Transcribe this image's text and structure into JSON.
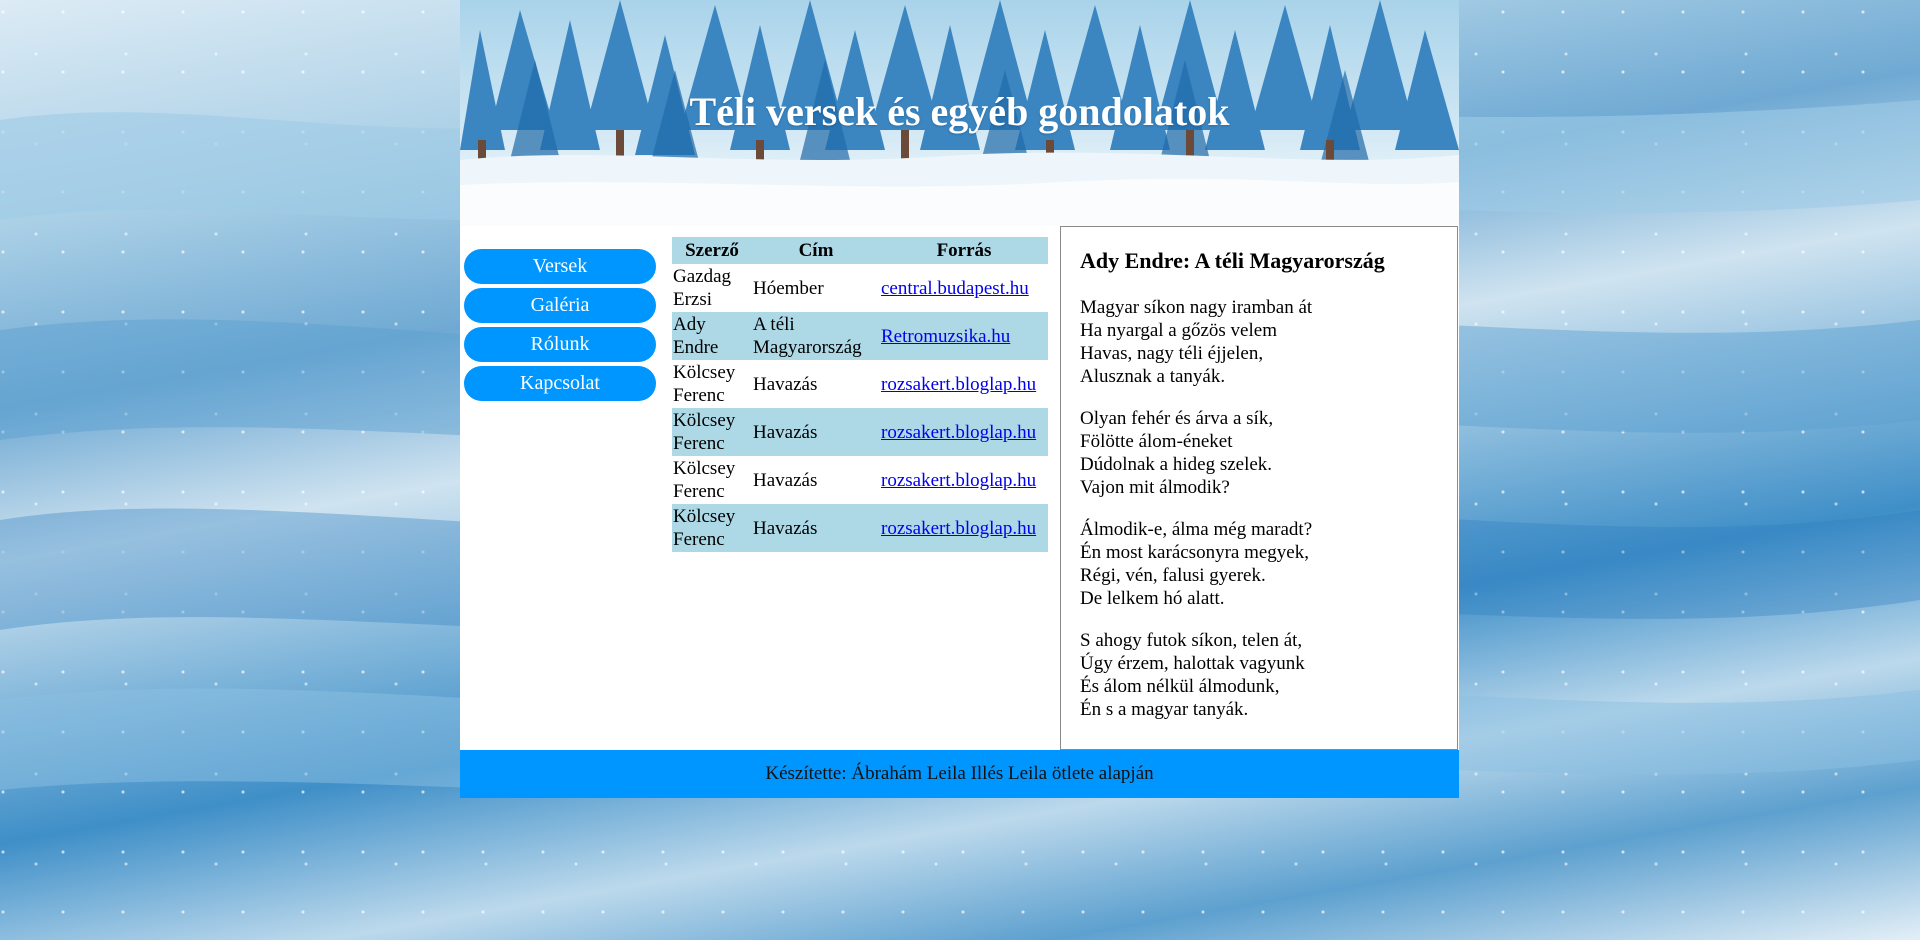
{
  "header": {
    "title": "Téli versek és egyéb gondolatok"
  },
  "nav": [
    "Versek",
    "Galéria",
    "Rólunk",
    "Kapcsolat"
  ],
  "table": {
    "headers": [
      "Szerző",
      "Cím",
      "Forrás"
    ],
    "rows": [
      {
        "author": "Gazdag Erzsi",
        "title": "Hóember",
        "source": "central.budapest.hu"
      },
      {
        "author": "Ady Endre",
        "title": "A téli Magyarország",
        "source": "Retromuzsika.hu"
      },
      {
        "author": "Kölcsey Ferenc",
        "title": "Havazás",
        "source": "rozsakert.bloglap.hu"
      },
      {
        "author": "Kölcsey Ferenc",
        "title": "Havazás",
        "source": "rozsakert.bloglap.hu"
      },
      {
        "author": "Kölcsey Ferenc",
        "title": "Havazás",
        "source": "rozsakert.bloglap.hu"
      },
      {
        "author": "Kölcsey Ferenc",
        "title": "Havazás",
        "source": "rozsakert.bloglap.hu"
      }
    ]
  },
  "poem": {
    "title": "Ady Endre: A téli Magyarország",
    "stanzas": [
      [
        "Magyar síkon nagy iramban át",
        "Ha nyargal a gőzös velem",
        "Havas, nagy téli éjjelen,",
        "Alusznak a tanyák."
      ],
      [
        "Olyan fehér és árva a sík,",
        "Fölötte álom-éneket",
        "Dúdolnak a hideg szelek.",
        "Vajon mit álmodik?"
      ],
      [
        "Álmodik-e, álma még maradt?",
        "Én most karácsonyra megyek,",
        "Régi, vén, falusi gyerek.",
        "De lelkem hó alatt."
      ],
      [
        "S ahogy futok síkon, telen át,",
        "Úgy érzem, halottak vagyunk",
        "És álom nélkül álmodunk,",
        "Én s a magyar tanyák."
      ]
    ]
  },
  "footer": {
    "text": "Készítette: Ábrahám Leila Illés Leila ötlete alapján"
  },
  "colors": {
    "accent": "#0096ff",
    "table_row": "#add8e6"
  }
}
